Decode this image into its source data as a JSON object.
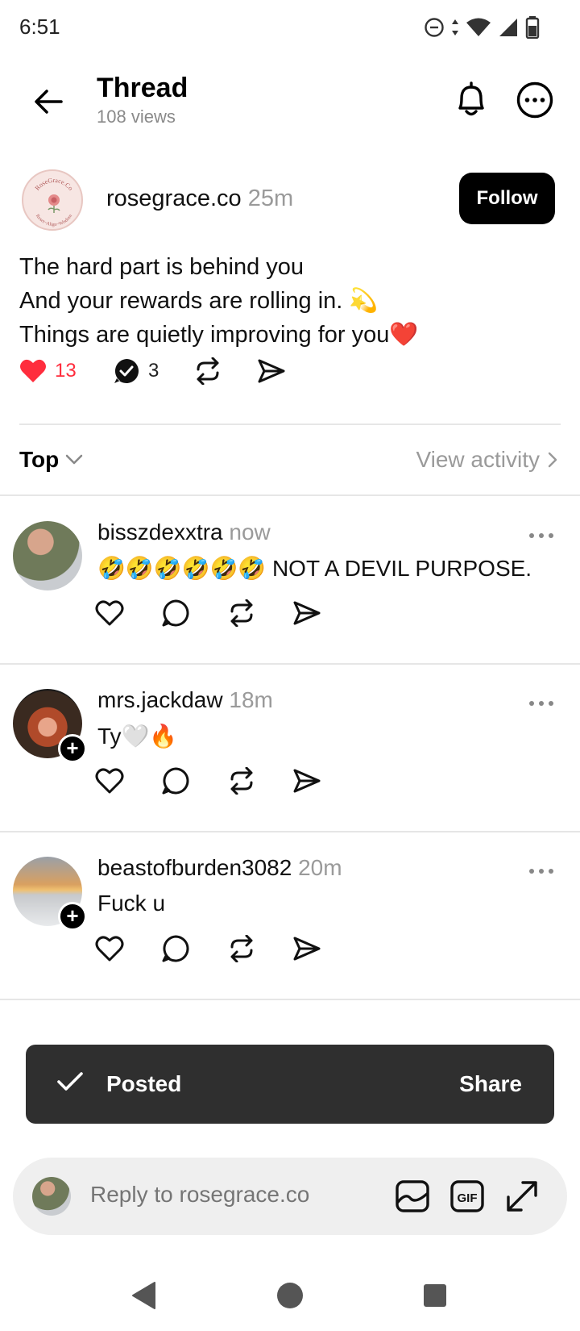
{
  "status": {
    "time": "6:51"
  },
  "header": {
    "title": "Thread",
    "views": "108 views"
  },
  "post": {
    "username": "rosegrace.co",
    "time": "25m",
    "follow_label": "Follow",
    "avatar_text_top": "RoseGrace.Co",
    "avatar_text_bottom": "Reset~Align~Wisdom",
    "lines": [
      "The hard part is behind you",
      "And your rewards are rolling in. 💫",
      "Things are quietly improving for you❤️"
    ],
    "likes": "13",
    "replies": "3",
    "like_color": "#ff2d3d"
  },
  "sort": {
    "label": "Top",
    "view_activity": "View activity"
  },
  "replies": [
    {
      "username": "bisszdexxtra",
      "time": "now",
      "text": "🤣🤣🤣🤣🤣🤣 NOT A DEVIL PURPOSE."
    },
    {
      "username": "mrs.jackdaw",
      "time": "18m",
      "text": "Ty🤍🔥"
    },
    {
      "username": "beastofburden3082",
      "time": "20m",
      "text": "Fuck u"
    }
  ],
  "toast": {
    "text": "Posted",
    "action": "Share"
  },
  "reply_bar": {
    "placeholder": "Reply to rosegrace.co"
  }
}
